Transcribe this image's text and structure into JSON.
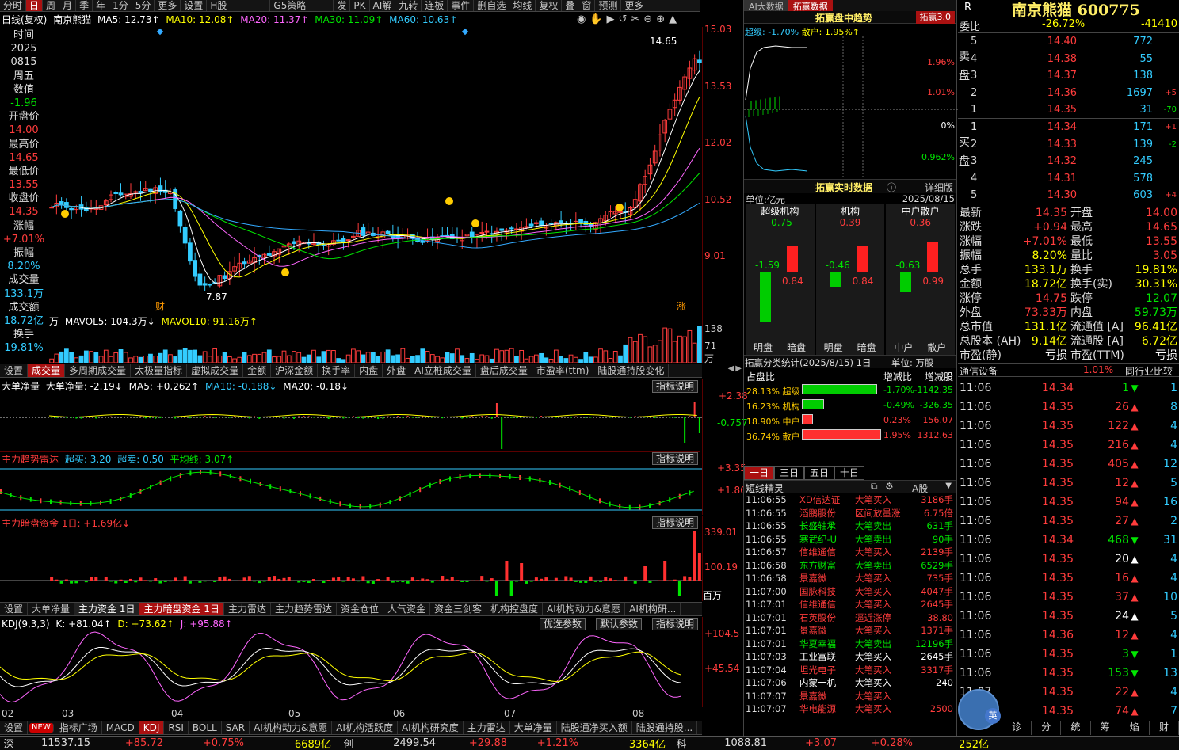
{
  "toolbar": [
    "分时",
    "日",
    "周",
    "月",
    "季",
    "年",
    "1分",
    "5分",
    "更多",
    "设置",
    "H股",
    "G5策略",
    "发",
    "PK",
    "AI解",
    "九转",
    "连板",
    "事件",
    "删自选",
    "均线",
    "复权",
    "叠",
    "窗",
    "预测",
    "更多"
  ],
  "kline_info": {
    "period": "日线(复权)",
    "name": "南京熊猫",
    "ma5": "MA5: 12.73↑",
    "ma10": "MA10: 12.08↑",
    "ma20": "MA20: 11.37↑",
    "ma30": "MA30: 11.09↑",
    "ma60": "MA60: 10.63↑"
  },
  "kline_axis": [
    "15.03",
    "13.53",
    "12.02",
    "10.52",
    "9.01"
  ],
  "kline_marks": {
    "high": "14.65",
    "low": "7.87",
    "cai": "财",
    "zhang": "涨"
  },
  "left_panel": [
    {
      "label": "时间",
      "value": "2025"
    },
    {
      "label": "",
      "value": "0815"
    },
    {
      "label": "周五",
      "value": ""
    },
    {
      "label": "数值",
      "value": "-1.96"
    },
    {
      "label": "开盘价",
      "value": "14.00"
    },
    {
      "label": "最高价",
      "value": "14.65"
    },
    {
      "label": "最低价",
      "value": "13.55"
    },
    {
      "label": "收盘价",
      "value": "14.35"
    },
    {
      "label": "涨幅",
      "value": "+7.01%"
    },
    {
      "label": "振幅",
      "value": "8.20%"
    },
    {
      "label": "成交量",
      "value": "133.1万"
    },
    {
      "label": "成交额",
      "value": "18.72亿"
    },
    {
      "label": "换手",
      "value": "19.81%"
    }
  ],
  "vol_info": {
    "unit": "万",
    "mavol5": "MAVOL5: 104.3万↓",
    "mavol10": "MAVOL10: 91.16万↑",
    "axis": [
      "138",
      "71",
      "万"
    ]
  },
  "tabs1": [
    "设置",
    "成交量",
    "多周期成交量",
    "太极量指标",
    "虚拟成交量",
    "金额",
    "沪深金额",
    "换手率",
    "内盘",
    "外盘",
    "AI立桩成交量",
    "盘后成交量",
    "市盈率(ttm)",
    "陆股通持股变化"
  ],
  "ind1": {
    "title": "大单净量",
    "name": "大单净量: -2.19↓",
    "ma5": "MA5: +0.262↑",
    "ma10": "MA10: -0.188↓",
    "ma20": "MA20: -0.18↓",
    "btn": "指标说明",
    "axis": [
      "+2.38",
      "-0.757"
    ]
  },
  "ind2": {
    "title": "主力趋势雷达",
    "cm": "超买: 3.20",
    "cs": "超卖: 0.50",
    "avg": "平均线: 3.07↑",
    "btn": "指标说明",
    "axis": [
      "+3.35",
      "+1.86"
    ]
  },
  "ind3": {
    "title": "主力暗盘资金 1日: +1.69亿↓",
    "btn": "指标说明",
    "axis": [
      "339.01",
      "100.19",
      "百万"
    ]
  },
  "tabs2": [
    "设置",
    "大单净量",
    "主力资金 1日",
    "主力暗盘资金 1日",
    "主力雷达",
    "主力趋势雷达",
    "资金仓位",
    "人气资金",
    "资金三剑客",
    "机构控盘度",
    "AI机构动力&意愿",
    "AI机构研..."
  ],
  "kdj": {
    "name": "KDJ(9,3,3)",
    "k": "K: +81.04↑",
    "d": "D: +73.62↑",
    "j": "J: +95.88↑",
    "btn1": "优选参数",
    "btn2": "默认参数",
    "btn3": "指标说明",
    "axis": [
      "+104.5",
      "+45.54"
    ]
  },
  "months": [
    "02",
    "03",
    "04",
    "05",
    "06",
    "07",
    "08"
  ],
  "tabs3": [
    "设置",
    "NEW",
    "指标广场",
    "MACD",
    "KDJ",
    "RSI",
    "BOLL",
    "SAR",
    "AI机构动力&意愿",
    "AI机构活跃度",
    "AI机构研究度",
    "主力雷达",
    "大单净量",
    "陆股通净买入额",
    "陆股通持股..."
  ],
  "mid_top": {
    "tag": "AI大数据",
    "tab": "拓赢数据",
    "title": "拓赢盘中趋势",
    "badge": "拓赢3.0",
    "super": "超级: -1.70%",
    "retail": "散户: 1.95%↑",
    "axis": [
      "1.96%",
      "1.01%",
      "0%",
      "0.962%"
    ]
  },
  "mid_rt": {
    "title": "拓赢实时数据",
    "detail": "详细版",
    "unit": "单位:亿元",
    "date": "2025/08/15",
    "cols": [
      {
        "name": "超级机构",
        "net": "-0.75",
        "in": "-1.59",
        "out": "0.84",
        "l1": "明盘",
        "l2": "暗盘",
        "h1": 0.62,
        "h2": 0.33
      },
      {
        "name": "机构",
        "net": "0.39",
        "in": "-0.46",
        "out": "0.84",
        "l1": "明盘",
        "l2": "暗盘",
        "h1": 0.18,
        "h2": 0.33
      },
      {
        "name": "中户散户",
        "net": "0.36",
        "in": "-0.63",
        "out": "0.99",
        "l1": "中户",
        "l2": "散户",
        "h1": 0.25,
        "h2": 0.39
      }
    ]
  },
  "mid_cls": {
    "title": "拓赢分类统计(2025/8/15) 1日",
    "unit": "单位: 万股",
    "hdr": [
      "占盘比",
      "增减比",
      "增减股"
    ],
    "rows": [
      {
        "pct": "28.13% 超级",
        "ratio": "-1.70%",
        "shares": "-1142.35",
        "bar": 0.95,
        "color": "#00cc00"
      },
      {
        "pct": "16.23% 机构",
        "ratio": "-0.49%",
        "shares": "-326.35",
        "bar": 0.28,
        "color": "#00cc00"
      },
      {
        "pct": "18.90% 中户",
        "ratio": "0.23%",
        "shares": "156.07",
        "bar": 0.14,
        "color": "#ff3030"
      },
      {
        "pct": "36.74% 散户",
        "ratio": "1.95%",
        "shares": "1312.63",
        "bar": 1.0,
        "color": "#ff3030"
      }
    ]
  },
  "mid_period_tabs": [
    "一日",
    "三日",
    "五日",
    "十日"
  ],
  "news": {
    "title": "短线精灵",
    "filter": "A股",
    "rows": [
      {
        "t": "11:06:55",
        "s": "XD信达证",
        "a": "大笔买入",
        "v": "3186手",
        "c": "r"
      },
      {
        "t": "11:06:55",
        "s": "滔鹏股份",
        "a": "区间放量涨",
        "v": "6.75倍",
        "c": "r"
      },
      {
        "t": "11:06:55",
        "s": "长盛轴承",
        "a": "大笔卖出",
        "v": "631手",
        "c": "g"
      },
      {
        "t": "11:06:55",
        "s": "寒武纪-U",
        "a": "大笔卖出",
        "v": "90手",
        "c": "g"
      },
      {
        "t": "11:06:57",
        "s": "信维通信",
        "a": "大笔买入",
        "v": "2139手",
        "c": "r"
      },
      {
        "t": "11:06:58",
        "s": "东方财富",
        "a": "大笔卖出",
        "v": "6529手",
        "c": "g"
      },
      {
        "t": "11:06:58",
        "s": "景嘉微",
        "a": "大笔买入",
        "v": "735手",
        "c": "r"
      },
      {
        "t": "11:07:00",
        "s": "国脉科技",
        "a": "大笔买入",
        "v": "4047手",
        "c": "r"
      },
      {
        "t": "11:07:01",
        "s": "信维通信",
        "a": "大笔买入",
        "v": "2645手",
        "c": "r"
      },
      {
        "t": "11:07:01",
        "s": "石英股份",
        "a": "逼近涨停",
        "v": "38.80",
        "c": "r"
      },
      {
        "t": "11:07:01",
        "s": "景嘉微",
        "a": "大笔买入",
        "v": "1371手",
        "c": "r"
      },
      {
        "t": "11:07:01",
        "s": "华夏幸福",
        "a": "大笔卖出",
        "v": "12196手",
        "c": "g"
      },
      {
        "t": "11:07:03",
        "s": "工业富联",
        "a": "大笔买入",
        "v": "2645手",
        "c": "w"
      },
      {
        "t": "11:07:04",
        "s": "坦光电子",
        "a": "大笔买入",
        "v": "3317手",
        "c": "r"
      },
      {
        "t": "11:07:06",
        "s": "内蒙一机",
        "a": "大笔买入",
        "v": "240",
        "c": "w"
      },
      {
        "t": "11:07:07",
        "s": "景嘉微",
        "a": "大笔买入",
        "v": "",
        "c": "r"
      },
      {
        "t": "11:07:07",
        "s": "华电能源",
        "a": "大笔买入",
        "v": "2500",
        "c": "r"
      }
    ]
  },
  "right": {
    "r": "R",
    "title": "南京熊猫 600775",
    "wb_label": "委比",
    "wb": "-26.72%",
    "wc": "-41410",
    "sell_label": "卖盘",
    "buy_label": "买盘",
    "asks": [
      {
        "n": "5",
        "p": "14.40",
        "v": "772",
        "c": ""
      },
      {
        "n": "4",
        "p": "14.38",
        "v": "55",
        "c": ""
      },
      {
        "n": "3",
        "p": "14.37",
        "v": "138",
        "c": ""
      },
      {
        "n": "2",
        "p": "14.36",
        "v": "1697",
        "c": "+5"
      },
      {
        "n": "1",
        "p": "14.35",
        "v": "31",
        "c": "-70"
      }
    ],
    "bids": [
      {
        "n": "1",
        "p": "14.34",
        "v": "171",
        "c": "+1"
      },
      {
        "n": "2",
        "p": "14.33",
        "v": "139",
        "c": "-2"
      },
      {
        "n": "3",
        "p": "14.32",
        "v": "245",
        "c": ""
      },
      {
        "n": "4",
        "p": "14.31",
        "v": "578",
        "c": ""
      },
      {
        "n": "5",
        "p": "14.30",
        "v": "603",
        "c": "+4"
      }
    ],
    "quote": [
      [
        "最新",
        "14.35",
        "r",
        "开盘",
        "14.00",
        "r"
      ],
      [
        "涨跌",
        "+0.94",
        "r",
        "最高",
        "14.65",
        "r"
      ],
      [
        "涨幅",
        "+7.01%",
        "r",
        "最低",
        "13.55",
        "r"
      ],
      [
        "振幅",
        "8.20%",
        "y",
        "量比",
        "3.05",
        "r"
      ],
      [
        "总手",
        "133.1万",
        "y",
        "换手",
        "19.81%",
        "y"
      ],
      [
        "金额",
        "18.72亿",
        "y",
        "换手(实)",
        "30.31%",
        "y"
      ],
      [
        "涨停",
        "14.75",
        "r",
        "跌停",
        "12.07",
        "g"
      ],
      [
        "外盘",
        "73.33万",
        "r",
        "内盘",
        "59.73万",
        "g"
      ],
      [
        "总市值",
        "131.1亿",
        "y",
        "流通值 [A]",
        "96.41亿",
        "y"
      ],
      [
        "总股本 (AH)",
        "9.14亿",
        "y",
        "流通股 [A]",
        "6.72亿",
        "y"
      ],
      [
        "市盈(静)",
        "亏损",
        "w",
        "市盈(TTM)",
        "亏损",
        "w"
      ]
    ],
    "comm_label": "通信设备",
    "comm_pct": "1.01%",
    "comm_btn": "同行业比较",
    "trades": [
      {
        "t": "11:06",
        "p": "14.34",
        "v": "1",
        "d": "g",
        "n": "1"
      },
      {
        "t": "11:06",
        "p": "14.35",
        "v": "26",
        "d": "r",
        "n": "8"
      },
      {
        "t": "11:06",
        "p": "14.35",
        "v": "122",
        "d": "r",
        "n": "4"
      },
      {
        "t": "11:06",
        "p": "14.35",
        "v": "216",
        "d": "r",
        "n": "4"
      },
      {
        "t": "11:06",
        "p": "14.35",
        "v": "405",
        "d": "r",
        "n": "12"
      },
      {
        "t": "11:06",
        "p": "14.35",
        "v": "12",
        "d": "r",
        "n": "5"
      },
      {
        "t": "11:06",
        "p": "14.35",
        "v": "94",
        "d": "r",
        "n": "16"
      },
      {
        "t": "11:06",
        "p": "14.35",
        "v": "27",
        "d": "r",
        "n": "2"
      },
      {
        "t": "11:06",
        "p": "14.34",
        "v": "468",
        "d": "g",
        "n": "31"
      },
      {
        "t": "11:06",
        "p": "14.35",
        "v": "20",
        "d": "w",
        "n": "4"
      },
      {
        "t": "11:06",
        "p": "14.35",
        "v": "16",
        "d": "r",
        "n": "4"
      },
      {
        "t": "11:06",
        "p": "14.35",
        "v": "37",
        "d": "r",
        "n": "10"
      },
      {
        "t": "11:06",
        "p": "14.35",
        "v": "24",
        "d": "w",
        "n": "5"
      },
      {
        "t": "11:06",
        "p": "14.36",
        "v": "12",
        "d": "r",
        "n": "4"
      },
      {
        "t": "11:06",
        "p": "14.35",
        "v": "3",
        "d": "g",
        "n": "1"
      },
      {
        "t": "11:06",
        "p": "14.35",
        "v": "153",
        "d": "g",
        "n": "13"
      },
      {
        "t": "11:07",
        "p": "14.35",
        "v": "22",
        "d": "r",
        "n": "4"
      },
      {
        "t": "11:07",
        "p": "14.35",
        "v": "74",
        "d": "r",
        "n": "7"
      }
    ],
    "btabs": [
      "诊",
      "分",
      "统",
      "筹",
      "焰",
      "财"
    ],
    "avatar_label": "英"
  },
  "status": {
    "i1": "深",
    "v1": "11537.15",
    "c1": "+85.72",
    "p1": "+0.75%",
    "a1": "6689亿",
    "i2": "创",
    "v2": "2499.54",
    "c2": "+29.88",
    "p2": "+1.21%",
    "a2": "3364亿",
    "i3": "科",
    "v3": "1088.81",
    "c3": "+3.07",
    "p3": "+0.28%",
    "a3": "252亿"
  }
}
